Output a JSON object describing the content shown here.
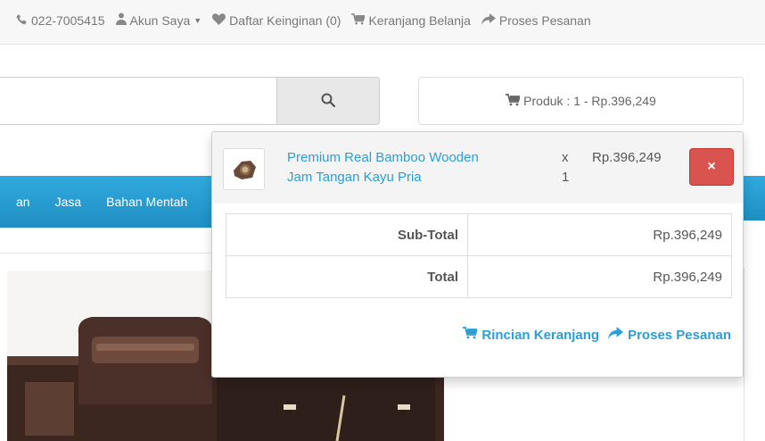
{
  "topbar": {
    "phone": "022-7005415",
    "account": "Akun Saya",
    "wishlist": "Daftar Keinginan (0)",
    "cart": "Keranjang Belanja",
    "checkout": "Proses Pesanan"
  },
  "search": {
    "placeholder": ""
  },
  "cart_button": {
    "label": "Produk : 1 - Rp.396,249"
  },
  "nav": {
    "items": [
      "an",
      "Jasa",
      "Bahan Mentah"
    ]
  },
  "dropdown": {
    "item": {
      "name_line1": "Premium Real Bamboo Wooden",
      "name_line2": "Jam Tangan Kayu Pria",
      "x": "x",
      "qty": "1",
      "price": "Rp.396,249",
      "remove": "×"
    },
    "totals": [
      {
        "label": "Sub-Total",
        "value": "Rp.396,249"
      },
      {
        "label": "Total",
        "value": "Rp.396,249"
      }
    ],
    "links": {
      "view_cart": "Rincian Keranjang",
      "checkout": "Proses Pesanan"
    }
  },
  "colors": {
    "accent": "#2a9fd6",
    "danger": "#d9534f",
    "nav_bg": "#2a9fd6"
  },
  "icons": [
    "phone-icon",
    "user-icon",
    "heart-icon",
    "cart-icon",
    "share-icon",
    "search-icon",
    "close-icon"
  ]
}
